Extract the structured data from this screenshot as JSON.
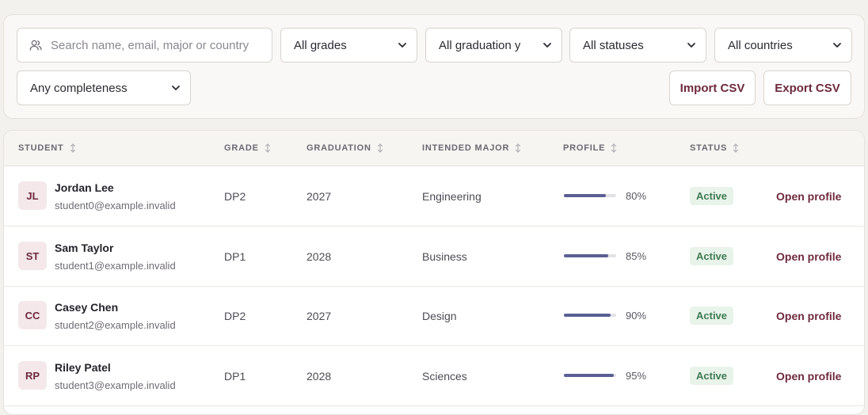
{
  "filters": {
    "search_placeholder": "Search name, email, major or country",
    "grade_select": "All grades",
    "graduation_select": "All graduation y",
    "status_select": "All statuses",
    "country_select": "All countries",
    "completeness_select": "Any completeness",
    "import_label": "Import CSV",
    "export_label": "Export CSV"
  },
  "table": {
    "columns": [
      "STUDENT",
      "GRADE",
      "GRADUATION",
      "INTENDED MAJOR",
      "PROFILE",
      "STATUS"
    ],
    "rows": [
      {
        "initials": "JL",
        "name": "Jordan Lee",
        "email": "student0@example.invalid",
        "grade": "DP2",
        "graduation": "2027",
        "major": "Engineering",
        "profile_pct": 80,
        "profile_label": "80%",
        "status": "Active",
        "action": "Open profile"
      },
      {
        "initials": "ST",
        "name": "Sam Taylor",
        "email": "student1@example.invalid",
        "grade": "DP1",
        "graduation": "2028",
        "major": "Business",
        "profile_pct": 85,
        "profile_label": "85%",
        "status": "Active",
        "action": "Open profile"
      },
      {
        "initials": "CC",
        "name": "Casey Chen",
        "email": "student2@example.invalid",
        "grade": "DP2",
        "graduation": "2027",
        "major": "Design",
        "profile_pct": 90,
        "profile_label": "90%",
        "status": "Active",
        "action": "Open profile"
      },
      {
        "initials": "RP",
        "name": "Riley Patel",
        "email": "student3@example.invalid",
        "grade": "DP1",
        "graduation": "2028",
        "major": "Sciences",
        "profile_pct": 95,
        "profile_label": "95%",
        "status": "Active",
        "action": "Open profile"
      }
    ]
  },
  "colors": {
    "accent": "#6e2a3d",
    "progress": "#5a5f93",
    "status_active_bg": "#e8f3ea",
    "status_active_text": "#3f7a52"
  },
  "icons": {
    "search": "users-icon",
    "select": "chevron-down-icon",
    "sort": "sort-arrows-icon"
  }
}
